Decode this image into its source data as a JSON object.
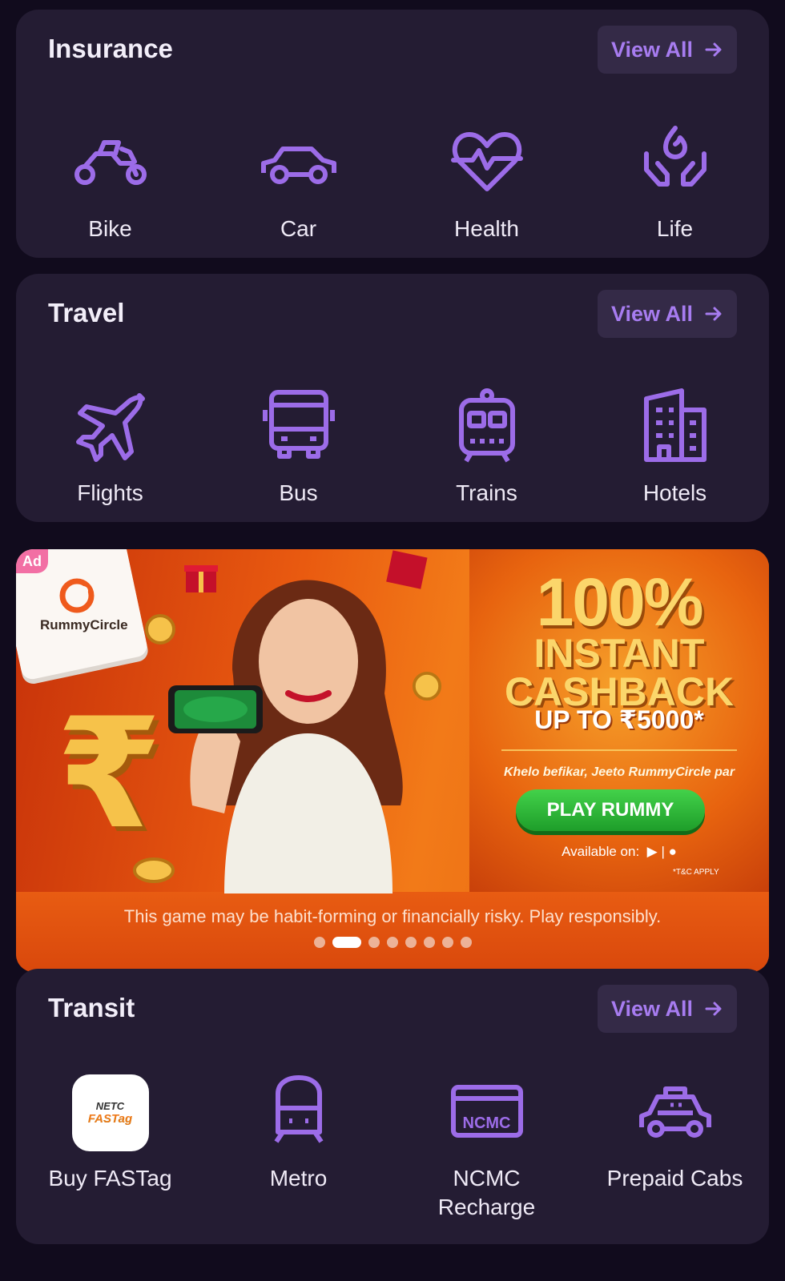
{
  "insurance": {
    "title": "Insurance",
    "view_all": "View All",
    "items": [
      {
        "label": "Bike",
        "icon": "motorbike-icon"
      },
      {
        "label": "Car",
        "icon": "car-icon"
      },
      {
        "label": "Health",
        "icon": "heart-pulse-icon"
      },
      {
        "label": "Life",
        "icon": "hands-flame-icon"
      }
    ]
  },
  "travel": {
    "title": "Travel",
    "view_all": "View All",
    "items": [
      {
        "label": "Flights",
        "icon": "airplane-icon"
      },
      {
        "label": "Bus",
        "icon": "bus-icon"
      },
      {
        "label": "Trains",
        "icon": "train-icon"
      },
      {
        "label": "Hotels",
        "icon": "hotel-building-icon"
      }
    ]
  },
  "banner": {
    "ad_label": "Ad",
    "brand": "RummyCircle",
    "headline_1": "100%",
    "headline_2": "INSTANT CASHBACK",
    "headline_3": "UP TO ₹5000*",
    "tagline": "Khelo befikar, Jeeto RummyCircle par",
    "cta": "PLAY RUMMY",
    "available": "Available on:",
    "tnc": "*T&C APPLY",
    "disclaimer": "This game may be habit-forming or financially risky. Play responsibly.",
    "slides": 8,
    "active_slide": 2
  },
  "transit": {
    "title": "Transit",
    "view_all": "View All",
    "items": [
      {
        "label": "Buy FASTag",
        "icon": "fastag-logo"
      },
      {
        "label": "Metro",
        "icon": "metro-icon"
      },
      {
        "label": "NCMC Recharge",
        "icon": "ncmc-card-icon",
        "card_text": "NCMC"
      },
      {
        "label": "Prepaid Cabs",
        "icon": "taxi-icon"
      }
    ],
    "fastag_logo_top": "NETC",
    "fastag_logo_main": "FASTag"
  },
  "colors": {
    "background": "#110b1d",
    "card": "#241c33",
    "accent": "#a77cf0",
    "icon_stroke": "#9c6ce8"
  }
}
